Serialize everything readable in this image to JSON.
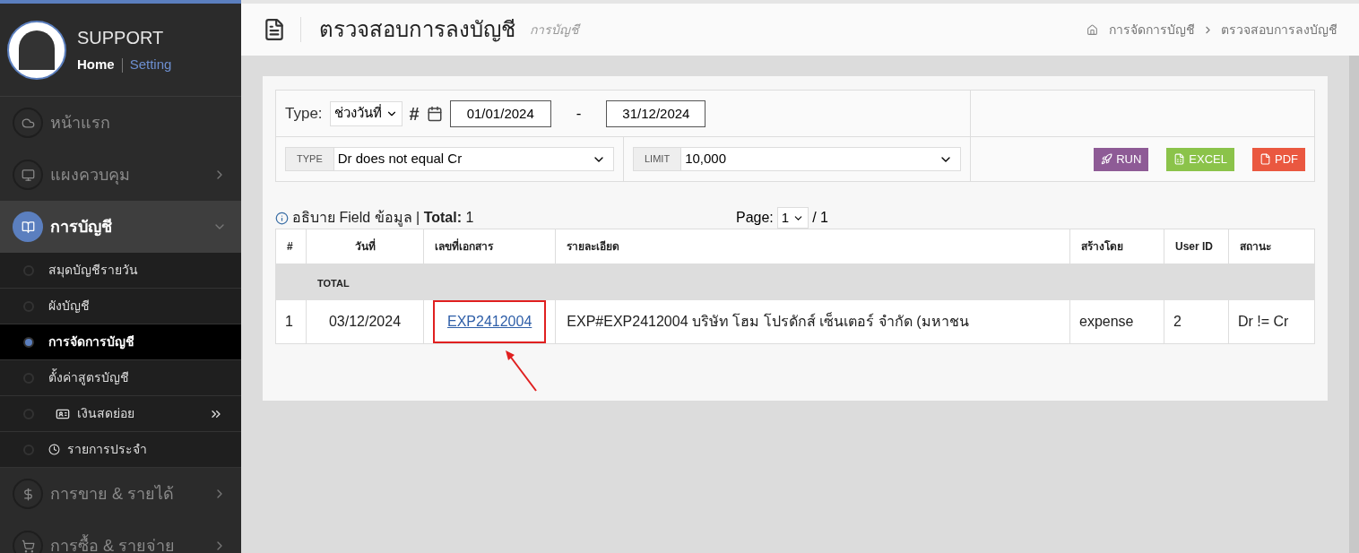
{
  "sidebar": {
    "user": {
      "name": "SUPPORT",
      "links": [
        {
          "label": "Home",
          "selected": true
        },
        {
          "label": "Setting",
          "selected": false
        }
      ]
    },
    "items": [
      {
        "label": "หน้าแรก",
        "kind": "link",
        "selected": false
      },
      {
        "label": "แผงควบคุม",
        "kind": "menu",
        "selected": false
      },
      {
        "label": "การบัญชี",
        "kind": "menu",
        "expanded": true,
        "selected": true,
        "children": [
          {
            "label": "สมุดบัญชีรายวัน",
            "kind": "plain",
            "selected": false
          },
          {
            "label": "ผังบัญชี",
            "kind": "plain",
            "selected": false
          },
          {
            "label": "การจัดการบัญชี",
            "kind": "plain",
            "selected": true
          },
          {
            "label": "ตั้งค่าสูตรบัญชี",
            "kind": "plain",
            "selected": false
          },
          {
            "label": "เงินสดย่อย",
            "kind": "submenu",
            "selected": false
          },
          {
            "label": "รายการประจำ",
            "kind": "clock",
            "selected": false
          }
        ]
      },
      {
        "label": "การขาย & รายได้",
        "kind": "menu",
        "selected": false
      },
      {
        "label": "การซื้อ & รายจ่าย",
        "kind": "menu",
        "selected": false
      }
    ]
  },
  "header": {
    "title": "ตรวจสอบการลงบัญชี",
    "subtitle": "การบัญชี",
    "breadcrumb": [
      "การจัดการบัญชี",
      "ตรวจสอบการลงบัญชี"
    ]
  },
  "filters": {
    "type_label": "Type:",
    "type_value": "ช่วงวันที่",
    "hash": "#",
    "date_from": "01/01/2024",
    "dash": "-",
    "date_to": "31/12/2024",
    "selects": [
      {
        "label": "TYPE",
        "value": "Dr does not equal Cr"
      },
      {
        "label": "LIMIT",
        "value": "10,000"
      }
    ],
    "buttons": [
      {
        "label": "RUN",
        "kind": "run"
      },
      {
        "label": "EXCEL",
        "kind": "excel"
      },
      {
        "label": "PDF",
        "kind": "pdf"
      }
    ]
  },
  "summary": {
    "field_info": "อธิบาย Field ข้อมูล | **Total:** 1",
    "page_label": "Page:",
    "page": "1",
    "page_total": "/ 1"
  },
  "table": {
    "columns": [
      "#",
      "วันที่",
      "เลขที่เอกสาร",
      "รายละเอียด",
      "สร้างโดย",
      "User ID",
      "สถานะ"
    ],
    "total_label": "TOTAL",
    "rows": [
      {
        "cells": [
          "1",
          "03/12/2024",
          "EXP2412004",
          "EXP#EXP2412004 บริษัท โฮม โปรดักส์ เซ็นเตอร์ จำกัด (มหาชน",
          "expense",
          "2",
          "Dr != Cr"
        ],
        "highlighted": true
      }
    ]
  }
}
